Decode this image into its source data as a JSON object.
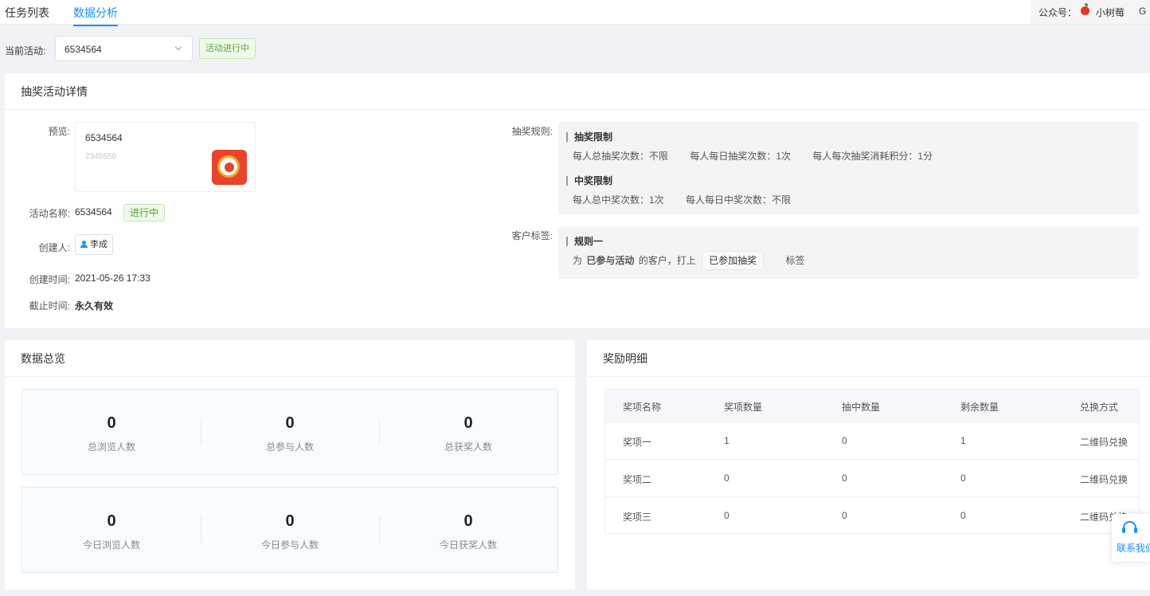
{
  "nav": {
    "tabs": [
      {
        "label": "任务列表",
        "active": false
      },
      {
        "label": "数据分析",
        "active": true
      }
    ],
    "account_label": "公众号：",
    "account_name": "小树莓",
    "account_extra": "G"
  },
  "activity_select": {
    "label": "当前活动:",
    "value": "6534564",
    "status": "活动进行中"
  },
  "detail": {
    "title": "抽奖活动详情",
    "preview_label": "预览:",
    "preview_title": "6534564",
    "preview_subtitle": "2345656",
    "name_label": "活动名称:",
    "name_value": "6534564",
    "name_status": "进行中",
    "creator_label": "创建人:",
    "creator_value": "李成",
    "created_label": "创建时间:",
    "created_value": "2021-05-26 17:33",
    "deadline_label": "截止时间:",
    "deadline_value": "永久有效",
    "rules_label": "抽奖规则:",
    "rule_groups": [
      {
        "title": "抽奖限制",
        "items": [
          "每人总抽奖次数：不限",
          "每人每日抽奖次数：1次",
          "每人每次抽奖消耗积分：1分"
        ]
      },
      {
        "title": "中奖限制",
        "items": [
          "每人总中奖次数：1次",
          "每人每日中奖次数：不限"
        ]
      }
    ],
    "tag_label": "客户标签:",
    "tag_rule": {
      "title": "规则一",
      "prefix": "为",
      "condition": "已参与活动",
      "middle": "的客户，打上",
      "tag": "已参加抽奖",
      "suffix": "标签"
    }
  },
  "overview": {
    "title": "数据总览",
    "total": [
      {
        "value": "0",
        "label": "总浏览人数"
      },
      {
        "value": "0",
        "label": "总参与人数"
      },
      {
        "value": "0",
        "label": "总获奖人数"
      }
    ],
    "today": [
      {
        "value": "0",
        "label": "今日浏览人数"
      },
      {
        "value": "0",
        "label": "今日参与人数"
      },
      {
        "value": "0",
        "label": "今日获奖人数"
      }
    ]
  },
  "rewards": {
    "title": "奖励明细",
    "columns": [
      "奖项名称",
      "奖项数量",
      "抽中数量",
      "剩余数量",
      "兑换方式"
    ],
    "rows": [
      [
        "奖项一",
        "1",
        "0",
        "1",
        "二维码兑换"
      ],
      [
        "奖项二",
        "0",
        "0",
        "0",
        "二维码兑换"
      ],
      [
        "奖项三",
        "0",
        "0",
        "0",
        "二维码兑换"
      ]
    ]
  },
  "contact": {
    "label": "联系我们"
  },
  "colors": {
    "accent": "#1890ff",
    "success": "#52a732",
    "success_bg": "#f0f9eb"
  }
}
